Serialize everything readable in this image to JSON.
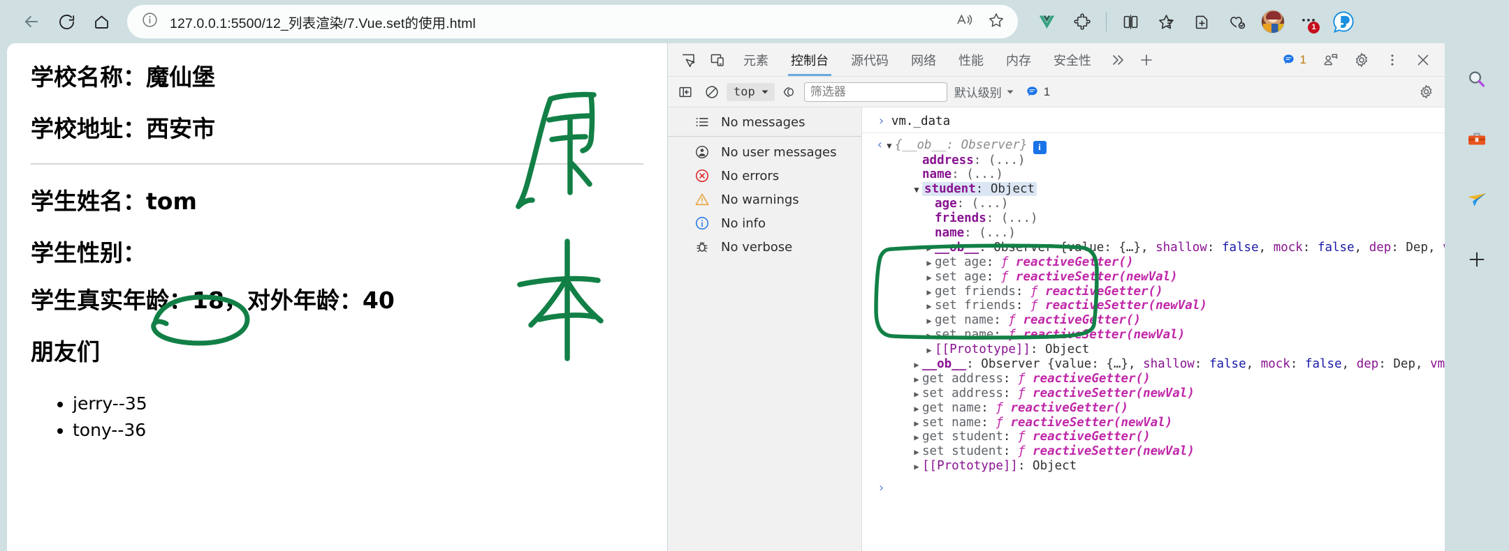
{
  "browser": {
    "back_label": "返回",
    "refresh_label": "刷新",
    "home_label": "主页",
    "url": "127.0.0.1:5500/12_列表渲染/7.Vue.set的使用.html",
    "read_aloud_label": "朗读此页面",
    "favorite_label": "添加到收藏夹",
    "icons": [
      "vue-devtools-icon",
      "extensions-icon",
      "split-screen-icon",
      "collections-icon",
      "add-page-icon",
      "browser-essentials-icon"
    ],
    "profile_label": "个人资料",
    "more_label": "设置及其他",
    "more_badge": "1",
    "copilot_label": "Copilot"
  },
  "page": {
    "school_name": "学校名称：魔仙堡",
    "school_address": "学校地址：西安市",
    "student_name": "学生姓名：tom",
    "student_gender": "学生性别：",
    "student_age": "学生真实年龄：18，对外年龄：40",
    "friends_title": "朋友们",
    "friends": [
      "jerry--35",
      "tony--36"
    ],
    "annotations": {
      "top_char": "原",
      "bottom_char": "本",
      "ink_color": "#128046"
    }
  },
  "devtools": {
    "inspect_label": "检查元素",
    "device_label": "设备模拟",
    "tabs": [
      {
        "label": "元素",
        "active": false
      },
      {
        "label": "控制台",
        "active": true
      },
      {
        "label": "源代码",
        "active": false
      },
      {
        "label": "网络",
        "active": false
      },
      {
        "label": "性能",
        "active": false
      },
      {
        "label": "内存",
        "active": false
      },
      {
        "label": "安全性",
        "active": false
      }
    ],
    "more_tabs_label": "更多工具",
    "add_tab_label": "添加",
    "issues_count": "1",
    "issues_label": "问题",
    "feedback_label": "反馈",
    "settings_label": "设置",
    "kebab_label": "自定义及控制",
    "close_label": "关闭",
    "console_toolbar": {
      "sidebar_toggle_label": "显示控制台侧边栏",
      "clear_label": "清除控制台",
      "context": "top",
      "eye_label": "实时表达式",
      "filter_placeholder": "筛选器",
      "filter_value": "",
      "level": "默认级别",
      "issue_count": "1"
    },
    "sidebar": [
      {
        "icon": "list-icon",
        "label": "No messages"
      },
      {
        "icon": "user-icon",
        "label": "No user messages"
      },
      {
        "icon": "error-icon",
        "label": "No errors"
      },
      {
        "icon": "warning-icon",
        "label": "No warnings"
      },
      {
        "icon": "info-icon",
        "label": "No info"
      },
      {
        "icon": "bug-icon",
        "label": "No verbose"
      }
    ],
    "console": {
      "command": "vm._data",
      "result_header": "{__ob__: Observer}",
      "observer_summary": "__ob__: Observer {value: {…}, shallow: false, mock: false, dep: Dep, vmCo",
      "prototype_label": "[[Prototype]]: Object",
      "lines": [
        {
          "indent": 2,
          "tri": "none",
          "key": "address",
          "sep": ": ",
          "value": "(...)",
          "kind": "dots"
        },
        {
          "indent": 2,
          "tri": "none",
          "key": "name",
          "sep": ": ",
          "value": "(...)",
          "kind": "dots"
        },
        {
          "indent": 2,
          "tri": "open",
          "key": "student",
          "sep": ": ",
          "value": "Object",
          "kind": "obj",
          "highlight": true
        },
        {
          "indent": 3,
          "tri": "none",
          "key": "age",
          "sep": ": ",
          "value": "(...)",
          "kind": "dots"
        },
        {
          "indent": 3,
          "tri": "none",
          "key": "friends",
          "sep": ": ",
          "value": "(...)",
          "kind": "dots"
        },
        {
          "indent": 3,
          "tri": "none",
          "key": "name",
          "sep": ": ",
          "value": "(...)",
          "kind": "dots"
        },
        {
          "indent": 3,
          "tri": "closed",
          "kind": "observer"
        },
        {
          "indent": 3,
          "tri": "closed",
          "key": "get age",
          "sep": ": ",
          "value": "reactiveGetter()",
          "kind": "fn"
        },
        {
          "indent": 3,
          "tri": "closed",
          "key": "set age",
          "sep": ": ",
          "value": "reactiveSetter(newVal)",
          "kind": "fn"
        },
        {
          "indent": 3,
          "tri": "closed",
          "key": "get friends",
          "sep": ": ",
          "value": "reactiveGetter()",
          "kind": "fn"
        },
        {
          "indent": 3,
          "tri": "closed",
          "key": "set friends",
          "sep": ": ",
          "value": "reactiveSetter(newVal)",
          "kind": "fn"
        },
        {
          "indent": 3,
          "tri": "closed",
          "key": "get name",
          "sep": ": ",
          "value": "reactiveGetter()",
          "kind": "fn"
        },
        {
          "indent": 3,
          "tri": "closed",
          "key": "set name",
          "sep": ": ",
          "value": "reactiveSetter(newVal)",
          "kind": "fn"
        },
        {
          "indent": 3,
          "tri": "closed",
          "kind": "proto"
        },
        {
          "indent": 2,
          "tri": "closed",
          "kind": "observer"
        },
        {
          "indent": 2,
          "tri": "closed",
          "key": "get address",
          "sep": ": ",
          "value": "reactiveGetter()",
          "kind": "fn"
        },
        {
          "indent": 2,
          "tri": "closed",
          "key": "set address",
          "sep": ": ",
          "value": "reactiveSetter(newVal)",
          "kind": "fn"
        },
        {
          "indent": 2,
          "tri": "closed",
          "key": "get name",
          "sep": ": ",
          "value": "reactiveGetter()",
          "kind": "fn"
        },
        {
          "indent": 2,
          "tri": "closed",
          "key": "set name",
          "sep": ": ",
          "value": "reactiveSetter(newVal)",
          "kind": "fn"
        },
        {
          "indent": 2,
          "tri": "closed",
          "key": "get student",
          "sep": ": ",
          "value": "reactiveGetter()",
          "kind": "fn"
        },
        {
          "indent": 2,
          "tri": "closed",
          "key": "set student",
          "sep": ": ",
          "value": "reactiveSetter(newVal)",
          "kind": "fn"
        },
        {
          "indent": 2,
          "tri": "closed",
          "kind": "proto"
        }
      ]
    }
  },
  "edge_rail": [
    {
      "icon": "search-icon",
      "label": "搜索"
    },
    {
      "icon": "toolbox-icon",
      "label": "工具"
    },
    {
      "icon": "paper-plane-icon",
      "label": "发送"
    },
    {
      "icon": "plus-icon",
      "label": "添加"
    }
  ],
  "colors": {
    "chrome_bg": "#cfdfe2",
    "accent_blue": "#1a73e8",
    "ink_green": "#128046",
    "tab_underline": "#6aa9e0"
  }
}
